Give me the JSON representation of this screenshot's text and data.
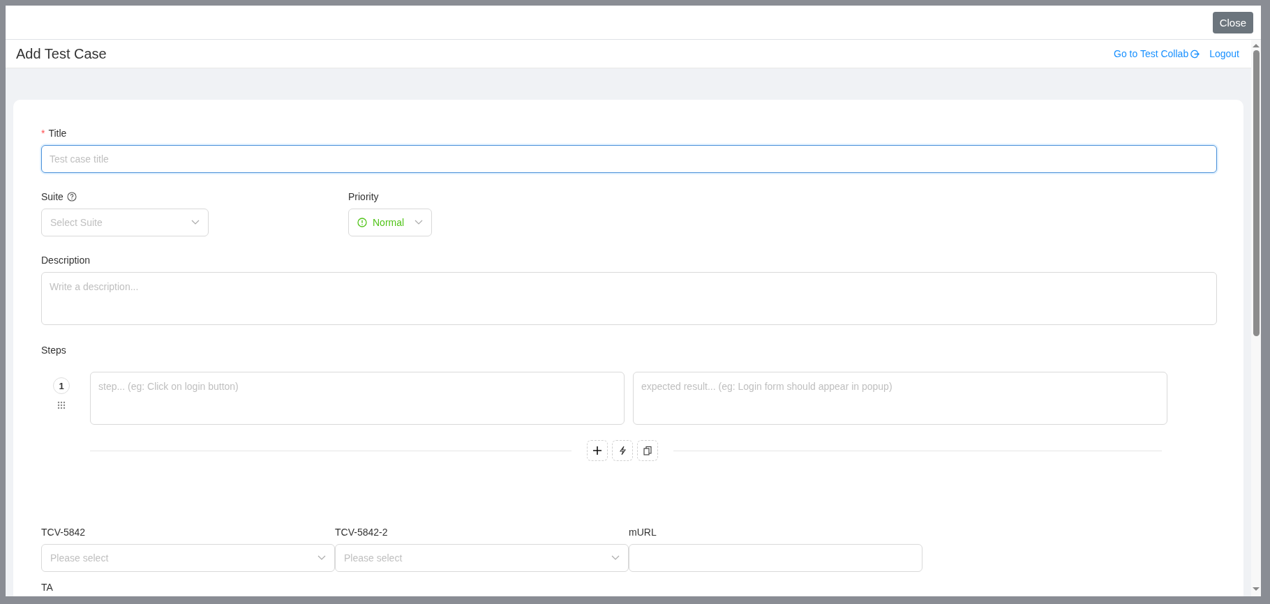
{
  "dialog": {
    "close_button": "Close",
    "title": "Add Test Case",
    "links": [
      {
        "label": "Go to Test Collab",
        "kind": "external"
      },
      {
        "label": "Logout",
        "kind": "plain"
      }
    ]
  },
  "form": {
    "title_field": {
      "label": "Title",
      "required_mark": "*",
      "placeholder": "Test case title",
      "focused": true
    },
    "suite": {
      "label": "Suite",
      "placeholder": "Select Suite"
    },
    "priority": {
      "label": "Priority",
      "value": "Normal"
    },
    "description": {
      "label": "Description",
      "placeholder": "Write a description..."
    },
    "steps": {
      "label": "Steps",
      "items": [
        {
          "number": "1",
          "step_placeholder": "step... (eg: Click on login button)",
          "expected_placeholder": "expected result... (eg: Login form should appear in popup)"
        }
      ]
    },
    "custom_fields": [
      {
        "label": "TCV-5842",
        "kind": "select",
        "placeholder": "Please select"
      },
      {
        "label": "TCV-5842-2",
        "kind": "select",
        "placeholder": "Please select"
      },
      {
        "label": "mURL",
        "kind": "text"
      }
    ],
    "next_field": {
      "label": "TA"
    }
  }
}
